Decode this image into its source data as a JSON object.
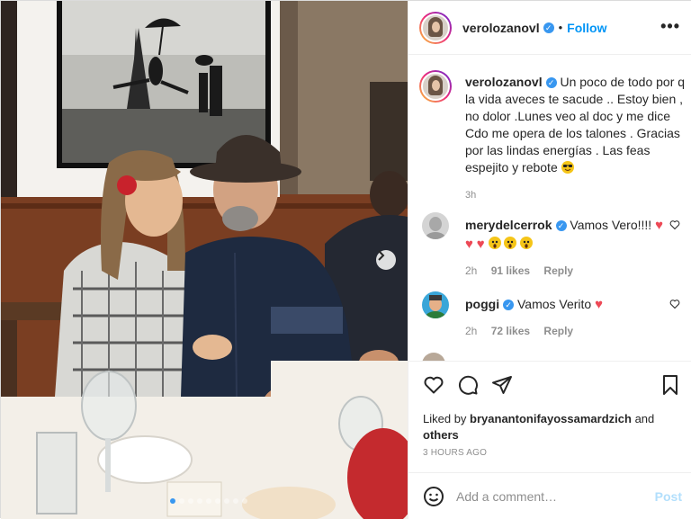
{
  "post": {
    "username": "verolozanovl",
    "follow_label": "Follow",
    "separator": "•",
    "more_label": "•••"
  },
  "caption": {
    "username": "verolozanovl",
    "text": "Un poco de todo por q la vida aveces te sacude .. Estoy bien , no dolor .Lunes veo al doc y me dice Cdo me opera de los talones . Gracias por las lindas energías . Las feas espejito y rebote",
    "emoji": "sunglasses-face",
    "time": "3h"
  },
  "comments": [
    {
      "username": "merydelcerrok",
      "text": "Vamos Vero!!!!",
      "emojis": [
        "red-heart",
        "red-heart",
        "red-heart",
        "screaming-face",
        "screaming-face",
        "screaming-face"
      ],
      "time": "2h",
      "likes": "91 likes",
      "reply": "Reply"
    },
    {
      "username": "poggi",
      "text": "Vamos Verito",
      "emojis": [
        "red-heart"
      ],
      "time": "2h",
      "likes": "72 likes",
      "reply": "Reply"
    }
  ],
  "likes": {
    "prefix": "Liked by",
    "user": "bryanantonifayossamardzich",
    "and": "and",
    "others": "others"
  },
  "timestamp": "3 HOURS AGO",
  "add_comment": {
    "placeholder": "Add a comment…",
    "post_label": "Post"
  },
  "carousel": {
    "slide_count": 9,
    "active_slide": 1
  },
  "colors": {
    "accent": "#0095f6",
    "verified": "#3897f0",
    "heart": "#ed4956",
    "muted": "#8e8e8e",
    "post_disabled": "#b2dffc"
  }
}
